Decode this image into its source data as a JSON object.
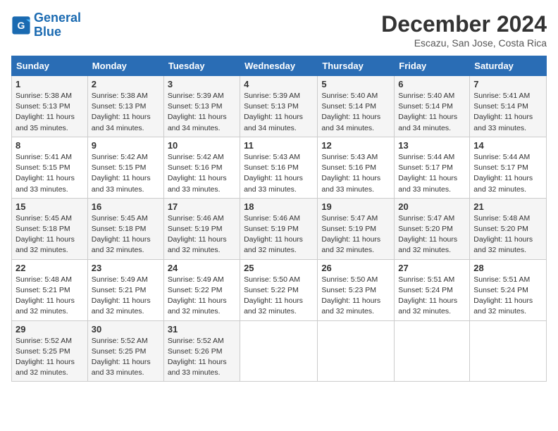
{
  "logo": {
    "text_general": "General",
    "text_blue": "Blue"
  },
  "title": "December 2024",
  "location": "Escazu, San Jose, Costa Rica",
  "days_of_week": [
    "Sunday",
    "Monday",
    "Tuesday",
    "Wednesday",
    "Thursday",
    "Friday",
    "Saturday"
  ],
  "weeks": [
    [
      {
        "day": "1",
        "info": "Sunrise: 5:38 AM\nSunset: 5:13 PM\nDaylight: 11 hours\nand 35 minutes."
      },
      {
        "day": "2",
        "info": "Sunrise: 5:38 AM\nSunset: 5:13 PM\nDaylight: 11 hours\nand 34 minutes."
      },
      {
        "day": "3",
        "info": "Sunrise: 5:39 AM\nSunset: 5:13 PM\nDaylight: 11 hours\nand 34 minutes."
      },
      {
        "day": "4",
        "info": "Sunrise: 5:39 AM\nSunset: 5:13 PM\nDaylight: 11 hours\nand 34 minutes."
      },
      {
        "day": "5",
        "info": "Sunrise: 5:40 AM\nSunset: 5:14 PM\nDaylight: 11 hours\nand 34 minutes."
      },
      {
        "day": "6",
        "info": "Sunrise: 5:40 AM\nSunset: 5:14 PM\nDaylight: 11 hours\nand 34 minutes."
      },
      {
        "day": "7",
        "info": "Sunrise: 5:41 AM\nSunset: 5:14 PM\nDaylight: 11 hours\nand 33 minutes."
      }
    ],
    [
      {
        "day": "8",
        "info": "Sunrise: 5:41 AM\nSunset: 5:15 PM\nDaylight: 11 hours\nand 33 minutes."
      },
      {
        "day": "9",
        "info": "Sunrise: 5:42 AM\nSunset: 5:15 PM\nDaylight: 11 hours\nand 33 minutes."
      },
      {
        "day": "10",
        "info": "Sunrise: 5:42 AM\nSunset: 5:16 PM\nDaylight: 11 hours\nand 33 minutes."
      },
      {
        "day": "11",
        "info": "Sunrise: 5:43 AM\nSunset: 5:16 PM\nDaylight: 11 hours\nand 33 minutes."
      },
      {
        "day": "12",
        "info": "Sunrise: 5:43 AM\nSunset: 5:16 PM\nDaylight: 11 hours\nand 33 minutes."
      },
      {
        "day": "13",
        "info": "Sunrise: 5:44 AM\nSunset: 5:17 PM\nDaylight: 11 hours\nand 33 minutes."
      },
      {
        "day": "14",
        "info": "Sunrise: 5:44 AM\nSunset: 5:17 PM\nDaylight: 11 hours\nand 32 minutes."
      }
    ],
    [
      {
        "day": "15",
        "info": "Sunrise: 5:45 AM\nSunset: 5:18 PM\nDaylight: 11 hours\nand 32 minutes."
      },
      {
        "day": "16",
        "info": "Sunrise: 5:45 AM\nSunset: 5:18 PM\nDaylight: 11 hours\nand 32 minutes."
      },
      {
        "day": "17",
        "info": "Sunrise: 5:46 AM\nSunset: 5:19 PM\nDaylight: 11 hours\nand 32 minutes."
      },
      {
        "day": "18",
        "info": "Sunrise: 5:46 AM\nSunset: 5:19 PM\nDaylight: 11 hours\nand 32 minutes."
      },
      {
        "day": "19",
        "info": "Sunrise: 5:47 AM\nSunset: 5:19 PM\nDaylight: 11 hours\nand 32 minutes."
      },
      {
        "day": "20",
        "info": "Sunrise: 5:47 AM\nSunset: 5:20 PM\nDaylight: 11 hours\nand 32 minutes."
      },
      {
        "day": "21",
        "info": "Sunrise: 5:48 AM\nSunset: 5:20 PM\nDaylight: 11 hours\nand 32 minutes."
      }
    ],
    [
      {
        "day": "22",
        "info": "Sunrise: 5:48 AM\nSunset: 5:21 PM\nDaylight: 11 hours\nand 32 minutes."
      },
      {
        "day": "23",
        "info": "Sunrise: 5:49 AM\nSunset: 5:21 PM\nDaylight: 11 hours\nand 32 minutes."
      },
      {
        "day": "24",
        "info": "Sunrise: 5:49 AM\nSunset: 5:22 PM\nDaylight: 11 hours\nand 32 minutes."
      },
      {
        "day": "25",
        "info": "Sunrise: 5:50 AM\nSunset: 5:22 PM\nDaylight: 11 hours\nand 32 minutes."
      },
      {
        "day": "26",
        "info": "Sunrise: 5:50 AM\nSunset: 5:23 PM\nDaylight: 11 hours\nand 32 minutes."
      },
      {
        "day": "27",
        "info": "Sunrise: 5:51 AM\nSunset: 5:24 PM\nDaylight: 11 hours\nand 32 minutes."
      },
      {
        "day": "28",
        "info": "Sunrise: 5:51 AM\nSunset: 5:24 PM\nDaylight: 11 hours\nand 32 minutes."
      }
    ],
    [
      {
        "day": "29",
        "info": "Sunrise: 5:52 AM\nSunset: 5:25 PM\nDaylight: 11 hours\nand 32 minutes."
      },
      {
        "day": "30",
        "info": "Sunrise: 5:52 AM\nSunset: 5:25 PM\nDaylight: 11 hours\nand 33 minutes."
      },
      {
        "day": "31",
        "info": "Sunrise: 5:52 AM\nSunset: 5:26 PM\nDaylight: 11 hours\nand 33 minutes."
      },
      {
        "day": "",
        "info": ""
      },
      {
        "day": "",
        "info": ""
      },
      {
        "day": "",
        "info": ""
      },
      {
        "day": "",
        "info": ""
      }
    ]
  ]
}
